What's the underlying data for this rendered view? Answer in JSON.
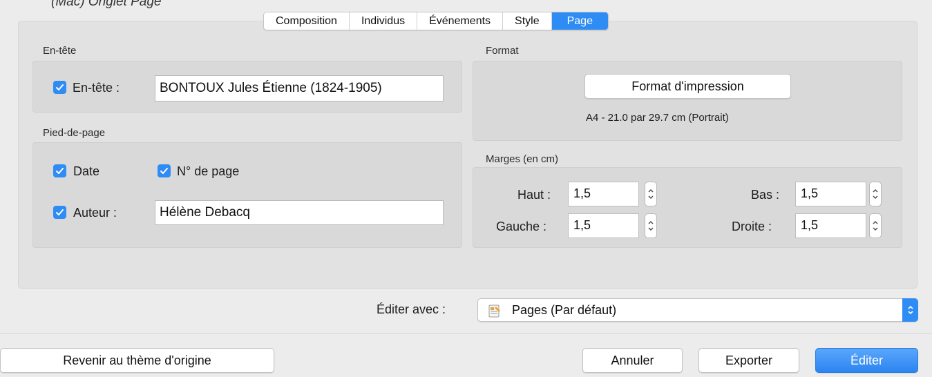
{
  "caption": "(Mac) Onglet Page",
  "tabs": [
    {
      "label": "Composition",
      "active": false
    },
    {
      "label": "Individus",
      "active": false
    },
    {
      "label": "Événements",
      "active": false
    },
    {
      "label": "Style",
      "active": false
    },
    {
      "label": "Page",
      "active": true
    }
  ],
  "header_section": {
    "title": "En-tête",
    "checkbox_label": "En-tête :",
    "checked": true,
    "value": "BONTOUX Jules Étienne (1824-1905)"
  },
  "footer_section": {
    "title": "Pied-de-page",
    "date_label": "Date",
    "date_checked": true,
    "page_number_label": "N° de page",
    "page_number_checked": true,
    "author_label": "Auteur :",
    "author_checked": true,
    "author_value": "Hélène Debacq"
  },
  "format_section": {
    "title": "Format",
    "button_label": "Format d'impression",
    "info": "A4 - 21.0 par 29.7 cm (Portrait)"
  },
  "margins_section": {
    "title": "Marges (en cm)",
    "top_label": "Haut :",
    "top_value": "1,5",
    "bottom_label": "Bas :",
    "bottom_value": "1,5",
    "left_label": "Gauche :",
    "left_value": "1,5",
    "right_label": "Droite :",
    "right_value": "1,5"
  },
  "edit_with": {
    "label": "Éditer avec :",
    "selected": "Pages (Par défaut)",
    "icon": "pages-app-icon"
  },
  "footer_buttons": {
    "revert": "Revenir au thème d'origine",
    "cancel": "Annuler",
    "export": "Exporter",
    "edit": "Éditer"
  },
  "colors": {
    "accent": "#2f8cf4",
    "background": "#ececec",
    "panel": "#e2e2e2",
    "group": "#d9d9d9"
  }
}
